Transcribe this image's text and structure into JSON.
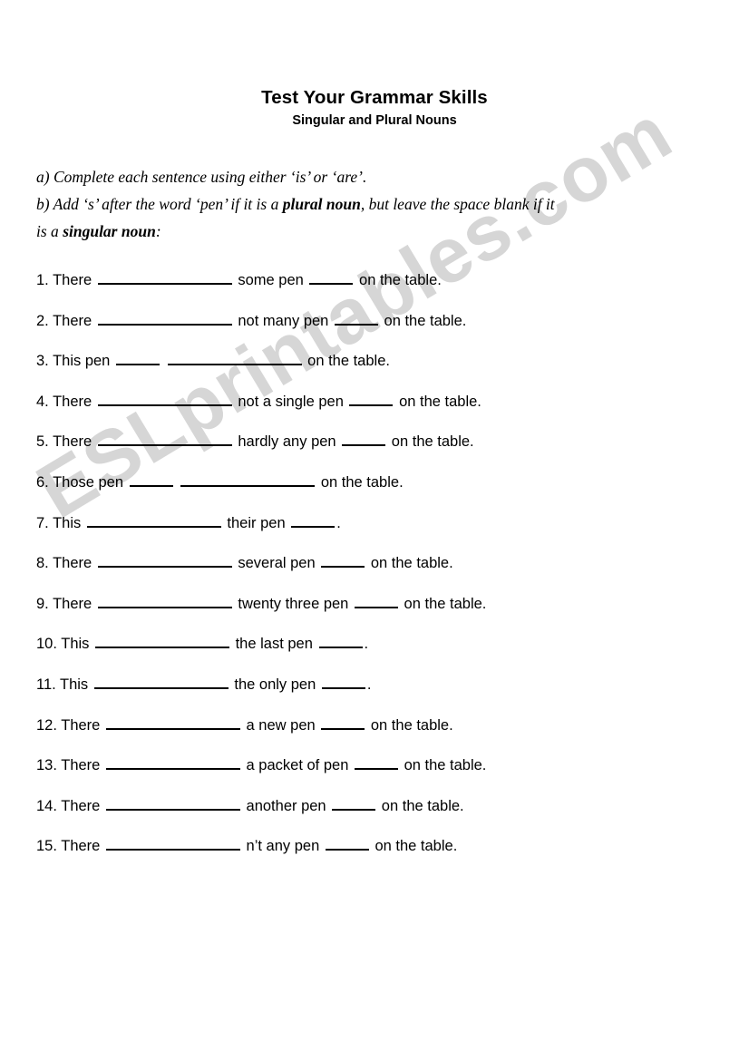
{
  "document": {
    "title": "Test Your Grammar Skills",
    "subtitle": "Singular and Plural Nouns"
  },
  "watermark": {
    "text": "ESLprintables.com",
    "color": "#d6d6d6"
  },
  "instructions": {
    "line_a": "a) Complete each sentence using either  ‘is’ or ‘are’.",
    "line_b_part1": "b) Add  ‘s’ after the word  ‘pen’ if it is a ",
    "line_b_bold1": "plural noun",
    "line_b_part2": ", but leave the space blank if it",
    "line_c_part1": "is a ",
    "line_c_bold1": "singular noun",
    "line_c_part2": ":"
  },
  "questions": [
    {
      "number": "1.",
      "pre": "There",
      "mid": "some pen",
      "post": "on the table.",
      "pattern": "long-mid-short-post"
    },
    {
      "number": "2.",
      "pre": "There",
      "mid": "not many pen",
      "post": "on the table.",
      "pattern": "long-mid-short-post"
    },
    {
      "number": "3.",
      "pre": "This pen",
      "mid": "",
      "post": "on the table.",
      "pattern": "short-long-post"
    },
    {
      "number": "4.",
      "pre": "There",
      "mid": "not a single pen",
      "post": "on the table.",
      "pattern": "long-mid-short-post"
    },
    {
      "number": "5.",
      "pre": "There",
      "mid": "hardly any pen",
      "post": "on the table.",
      "pattern": "long-mid-short-post"
    },
    {
      "number": "6.",
      "pre": "Those pen",
      "mid": "",
      "post": "on the table.",
      "pattern": "short-long-post"
    },
    {
      "number": "7.",
      "pre": "This",
      "mid": "their pen",
      "post": ".",
      "pattern": "long-mid-short-period"
    },
    {
      "number": "8.",
      "pre": "There",
      "mid": "several pen",
      "post": "on the table.",
      "pattern": "long-mid-short-post"
    },
    {
      "number": "9.",
      "pre": "There",
      "mid": "twenty three pen",
      "post": "on the table.",
      "pattern": "long-mid-short-post"
    },
    {
      "number": "10.",
      "pre": "This",
      "mid": "the last pen",
      "post": ".",
      "pattern": "long-mid-short-period"
    },
    {
      "number": "11.",
      "pre": "This",
      "mid": "the only pen",
      "post": ".",
      "pattern": "long-mid-short-period"
    },
    {
      "number": "12.",
      "pre": "There",
      "mid": "a new pen",
      "post": "on the table.",
      "pattern": "long-mid-short-post"
    },
    {
      "number": "13.",
      "pre": "There",
      "mid": "a packet of pen",
      "post": "on the table.",
      "pattern": "long-mid-short-post"
    },
    {
      "number": "14.",
      "pre": "There",
      "mid": "another pen",
      "post": "on the table.",
      "pattern": "long-mid-short-post"
    },
    {
      "number": "15.",
      "pre": "There",
      "mid": "n’t any pen",
      "post": "on the table.",
      "pattern": "long-mid-short-post"
    }
  ]
}
